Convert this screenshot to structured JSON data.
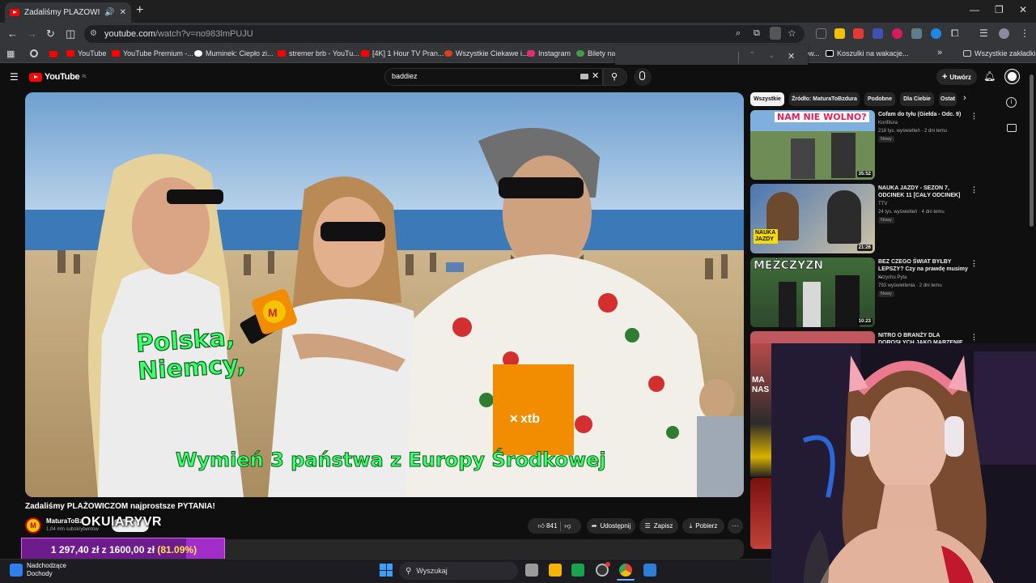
{
  "browser": {
    "tab_title": "Zadaliśmy PLAŻOWICZOM",
    "url_host": "youtube.com",
    "url_path": "/watch?v=no983lmPUJU",
    "bookmarks": [
      {
        "label": "YouTube"
      },
      {
        "label": "YouTube Premium -..."
      },
      {
        "label": "Muminek: Ciepło zi..."
      },
      {
        "label": "stremer brb - YouTu..."
      },
      {
        "label": "[4K] 1 Hour TV Pran..."
      },
      {
        "label": "Wszystkie Ciekawe i..."
      },
      {
        "label": "Instagram"
      },
      {
        "label": "Bilety na l"
      },
      {
        "label": "Koszulki na wakacje..."
      }
    ],
    "bookmarks_folder": "Wszystkie zakładki",
    "bookmark_trunc": "ow..."
  },
  "youtube": {
    "logo": "YouTube",
    "logo_region": "PL",
    "search_query": "baddiez",
    "create_label": "Utwórz",
    "video": {
      "subtitle_line1": "Polska,",
      "subtitle_line2": "Niemcy,",
      "caption": "Wymień 3 państwa z Europy Środkowej",
      "mic_logo": "M",
      "sign_text": "xtb"
    },
    "title": "Zadaliśmy PLAŻOWICZOM najprostsze PYTANIA!",
    "channel": {
      "avatar": "M",
      "name": "MaturaToBz",
      "subscribers": "1,04 mln subskrybentów",
      "overlay_name": "OKUlARYVR"
    },
    "actions": {
      "likes": "841",
      "share": "Udostępnij",
      "save": "Zapisz",
      "download": "Pobierz",
      "more": "···"
    },
    "goal": {
      "current": "1 297,40 zł",
      "sep": "z",
      "target": "1600,00 zł",
      "percent": "(81.09%)",
      "fraction": 0.8109
    },
    "chips": [
      "Wszystkie",
      "Źródło: MaturaToBzdura",
      "Podobne",
      "Dla Ciebie",
      "Ostat"
    ],
    "recommendations": [
      {
        "title": "Cofam do tyłu (Giełda - Odc. 9)",
        "channel": "Konfitura",
        "views": "218 tys. wyświetleń · 2 dni temu",
        "badge": "Nowy",
        "duration": "35:52",
        "thumb_text": "NAM NIE WOLNO?"
      },
      {
        "title": "NAUKA JAZDY - SEZON 7, ODCINEK 11 [CAŁY ODCINEK]",
        "channel": "TTV",
        "views": "24 tys. wyświetleń · 4 dni temu",
        "badge": "Nowy",
        "duration": "21:26",
        "thumb_text": "NAUKA JAZDY"
      },
      {
        "title": "BEZ CZEGO ŚWIAT BYŁBY LEPSZY? Czy na prawdę musimy ...",
        "channel": "Krzychu Pyta",
        "views": "793 wyświetlenia · 2 dni temu",
        "badge": "Nowy",
        "duration": "10:23",
        "thumb_text": "MĘŻCZYZN"
      },
      {
        "title": "NITRO O BRANŻY DLA DOROSŁYCH JAKO MARZENIE ...",
        "channel": "",
        "views": "",
        "badge": "",
        "duration": "",
        "thumb_text": "MA NAS"
      }
    ]
  },
  "taskbar": {
    "weather_title": "Nadchodzące",
    "weather_sub": "Dochody",
    "search_placeholder": "Wyszukaj"
  }
}
